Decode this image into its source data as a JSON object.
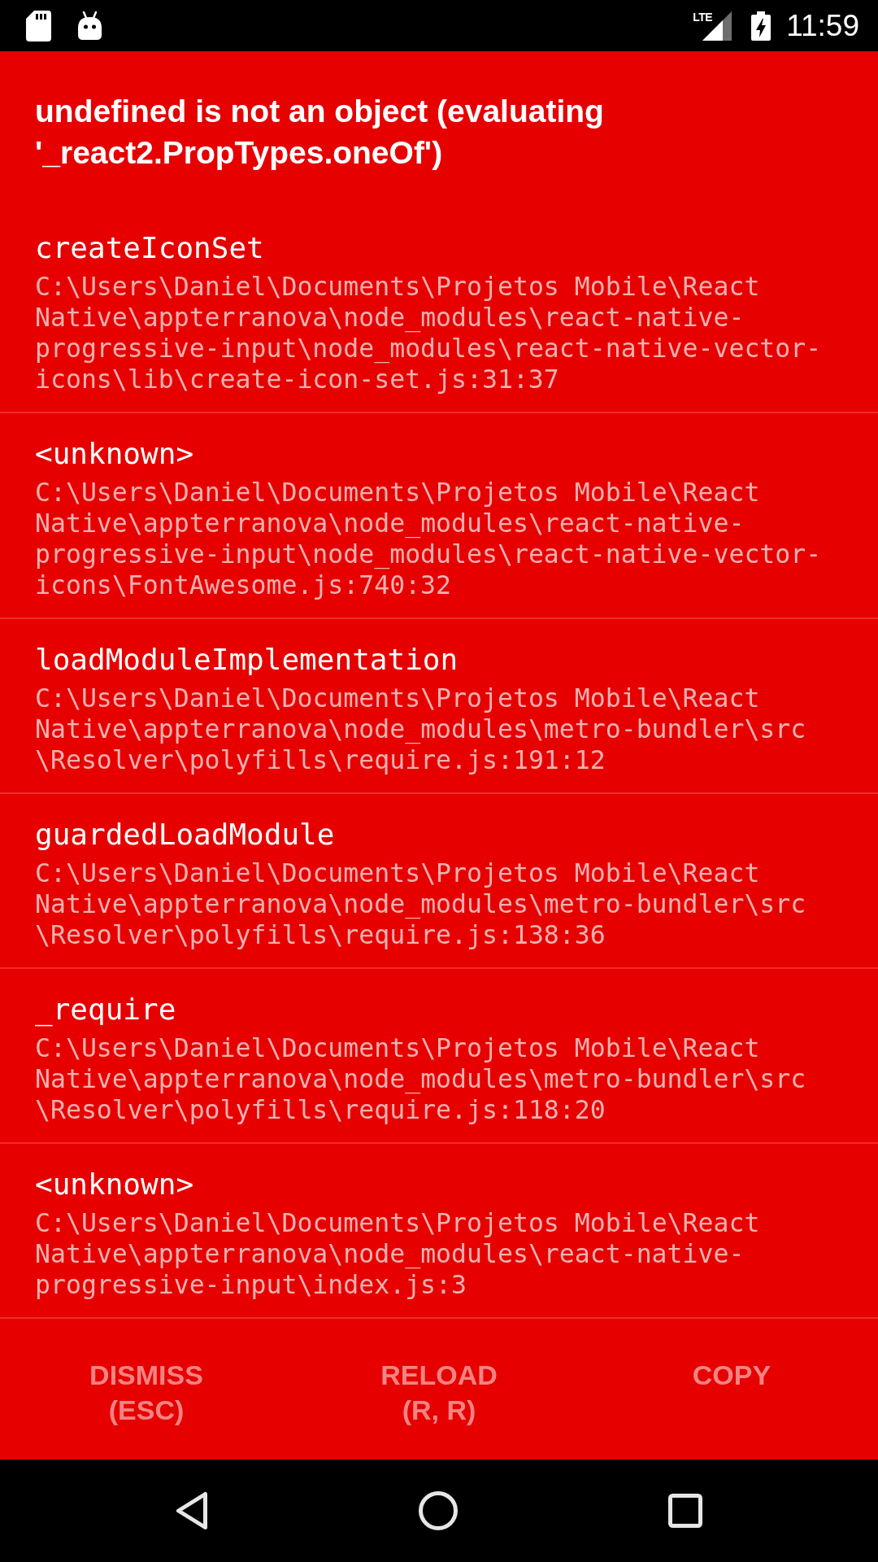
{
  "status_bar": {
    "network": "LTE",
    "time": "11:59"
  },
  "error": {
    "message": "undefined is not an object (evaluating '_react2.PropTypes.oneOf')"
  },
  "stack_frames": [
    {
      "method": "createIconSet",
      "path": "C:\\Users\\Daniel\\Documents\\Projetos Mobile\\React Native\\appterranova\\node_modules\\react-native-progressive-input\\node_modules\\react-native-vector-icons\\lib\\create-icon-set.js:31:37"
    },
    {
      "method": "<unknown>",
      "path": "C:\\Users\\Daniel\\Documents\\Projetos Mobile\\React Native\\appterranova\\node_modules\\react-native-progressive-input\\node_modules\\react-native-vector-icons\\FontAwesome.js:740:32"
    },
    {
      "method": "loadModuleImplementation",
      "path": "C:\\Users\\Daniel\\Documents\\Projetos Mobile\\React Native\\appterranova\\node_modules\\metro-bundler\\src\\Resolver\\polyfills\\require.js:191:12"
    },
    {
      "method": "guardedLoadModule",
      "path": "C:\\Users\\Daniel\\Documents\\Projetos Mobile\\React Native\\appterranova\\node_modules\\metro-bundler\\src\\Resolver\\polyfills\\require.js:138:36"
    },
    {
      "method": "_require",
      "path": "C:\\Users\\Daniel\\Documents\\Projetos Mobile\\React Native\\appterranova\\node_modules\\metro-bundler\\src\\Resolver\\polyfills\\require.js:118:20"
    },
    {
      "method": "<unknown>",
      "path": "C:\\Users\\Daniel\\Documents\\Projetos Mobile\\React Native\\appterranova\\node_modules\\react-native-progressive-input\\index.js:3"
    }
  ],
  "buttons": [
    {
      "label": "DISMISS",
      "shortcut": "(ESC)"
    },
    {
      "label": "RELOAD",
      "shortcut": "(R, R)"
    },
    {
      "label": "COPY"
    }
  ]
}
